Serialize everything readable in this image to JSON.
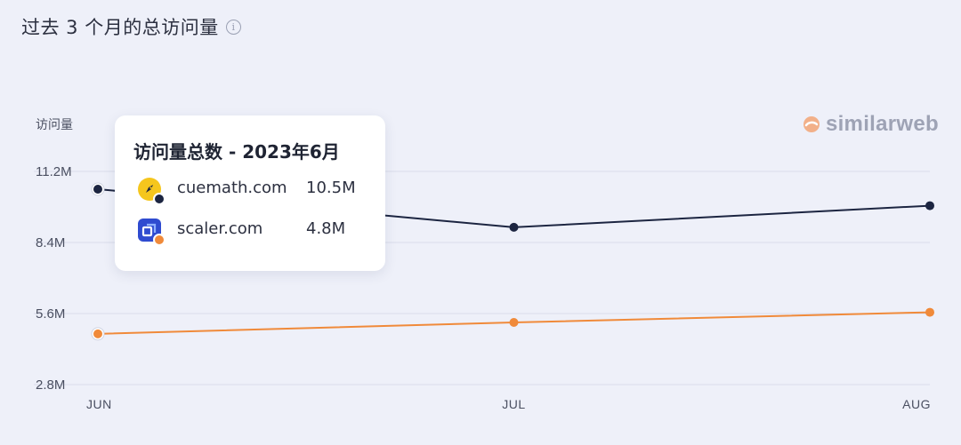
{
  "header": {
    "title": "过去 3 个月的总访问量",
    "info_icon": "info-icon",
    "info_glyph": "i"
  },
  "brand": {
    "name": "similarweb",
    "color": "#f0a476"
  },
  "chart_data": {
    "type": "line",
    "ylabel": "访问量",
    "categories": [
      "JUN",
      "JUL",
      "AUG"
    ],
    "yticks": [
      "11.2M",
      "8.4M",
      "5.6M",
      "2.8M"
    ],
    "ylim": [
      2.8,
      11.2
    ],
    "grid": true,
    "series": [
      {
        "name": "cuemath.com",
        "color": "#1c2541",
        "values": [
          10.5,
          9.0,
          9.85
        ]
      },
      {
        "name": "scaler.com",
        "color": "#f08a3a",
        "values": [
          4.8,
          5.25,
          5.65
        ]
      }
    ]
  },
  "tooltip": {
    "title": "访问量总数 - 2023年6月",
    "rows": [
      {
        "name": "cuemath.com",
        "value": "10.5M",
        "icon": "rocket-icon",
        "icon_bg": "#f5c61d",
        "dot_color": "#1c2541"
      },
      {
        "name": "scaler.com",
        "value": "4.8M",
        "icon": "scaler-logo-icon",
        "icon_bg": "#2f4bd0",
        "dot_color": "#f08a3a"
      }
    ]
  }
}
